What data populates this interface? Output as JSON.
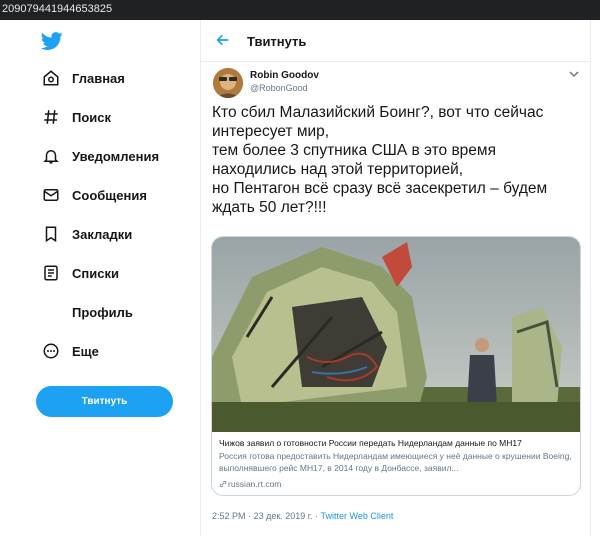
{
  "browser": {
    "url_fragment": "209079441944653825"
  },
  "sidebar": {
    "items": [
      {
        "label": "Главная",
        "icon": "home-icon"
      },
      {
        "label": "Поиск",
        "icon": "hashtag-icon"
      },
      {
        "label": "Уведомления",
        "icon": "bell-icon"
      },
      {
        "label": "Сообщения",
        "icon": "envelope-icon"
      },
      {
        "label": "Закладки",
        "icon": "bookmark-icon"
      },
      {
        "label": "Списки",
        "icon": "list-icon"
      },
      {
        "label": "Профиль",
        "icon": ""
      },
      {
        "label": "Еще",
        "icon": "more-dots-icon"
      }
    ],
    "tweet_button": "Твитнуть"
  },
  "header": {
    "title": "Твитнуть"
  },
  "tweet": {
    "author_name": "Robin Goodov",
    "author_handle": "@RobonGood",
    "text": "Кто сбил Малазийский Боинг?, вот что сейчас интересует мир,\nтем более 3 спутника США в это время находились над этой территорией,\nно Пентагон всё сразу всё засекретил – будем ждать 50 лет?!!!",
    "card": {
      "title": "Чижов заявил о готовности России передать Нидерландам данные по МН17",
      "description": "Россия готова предоставить Нидерландам имеющиеся у неё данные о крушении Boeing, выполнявшего рейс МН17, в 2014 году в Донбассе, заявил...",
      "domain": "russian.rt.com"
    },
    "time": "2:52 PM",
    "date": "23 дек. 2019 г.",
    "separator": "·",
    "client": "Twitter Web Client"
  },
  "colors": {
    "accent": "#1da1f2",
    "text": "#14171a",
    "secondary": "#657786",
    "border": "#e6ecf0"
  }
}
